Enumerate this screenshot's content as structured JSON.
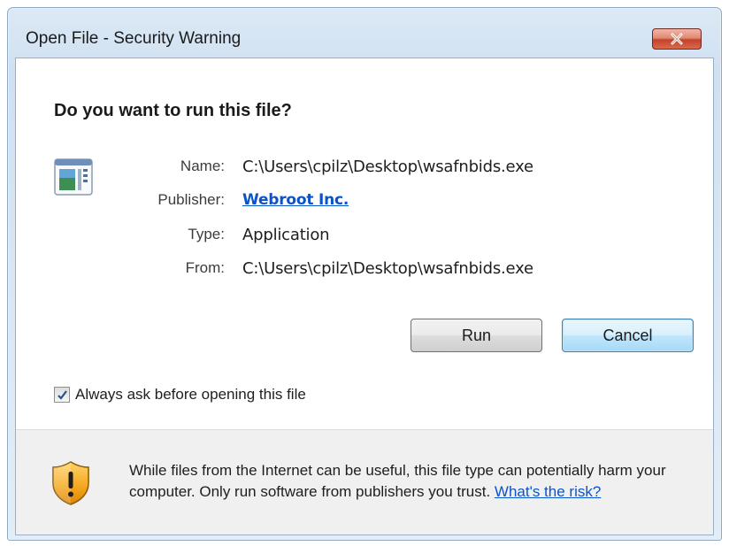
{
  "window": {
    "title": "Open File - Security Warning",
    "close_icon": "close-icon"
  },
  "dialog": {
    "question": "Do you want to run this file?",
    "file_icon": "application-file-icon",
    "fields": {
      "name_label": "Name:",
      "name_value": "C:\\Users\\cpilz\\Desktop\\wsafnbids.exe",
      "publisher_label": "Publisher:",
      "publisher_value": "Webroot Inc.",
      "type_label": "Type:",
      "type_value": "Application",
      "from_label": "From:",
      "from_value": "C:\\Users\\cpilz\\Desktop\\wsafnbids.exe"
    },
    "buttons": {
      "run_label": "Run",
      "cancel_label": "Cancel"
    },
    "checkbox": {
      "label": "Always ask before opening this file",
      "checked": true
    }
  },
  "footer": {
    "shield_icon": "warning-shield-icon",
    "warning_text": "While files from the Internet can be useful, this file type can potentially harm your computer. Only run software from publishers you trust.",
    "risk_link": "What's the risk?"
  },
  "colors": {
    "link": "#0b53c8",
    "close_button": "#c7412a",
    "default_button_border": "#3c7fb1"
  }
}
